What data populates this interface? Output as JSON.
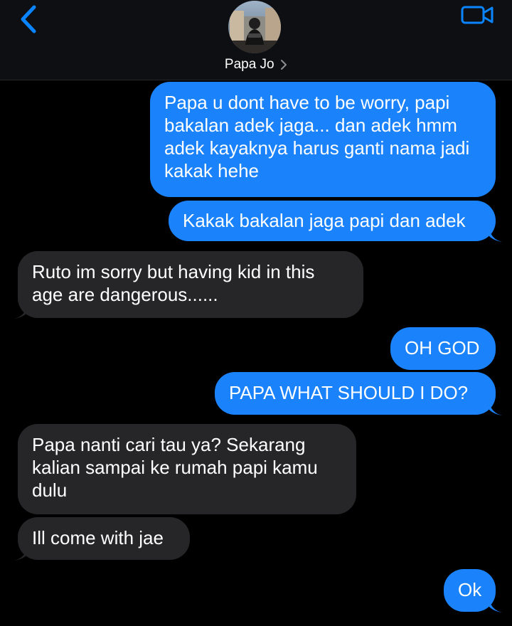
{
  "header": {
    "contact_name": "Papa Jo",
    "accent_color": "#0A84FF"
  },
  "messages": [
    {
      "direction": "outgoing",
      "text": "Papa u dont have to be worry, papi bakalan adek jaga... dan adek hmm adek kayaknya harus ganti nama jadi kakak hehe"
    },
    {
      "direction": "outgoing",
      "text": "Kakak bakalan jaga papi dan adek"
    },
    {
      "direction": "incoming",
      "text": "Ruto im sorry but having kid in this age are dangerous......"
    },
    {
      "direction": "outgoing",
      "text": "OH GOD"
    },
    {
      "direction": "outgoing",
      "text": "PAPA WHAT SHOULD I DO?"
    },
    {
      "direction": "incoming",
      "text": "Papa nanti cari tau ya? Sekarang kalian sampai ke rumah papi kamu dulu"
    },
    {
      "direction": "incoming",
      "text": "Ill come with jae"
    },
    {
      "direction": "outgoing",
      "text": "Ok"
    }
  ],
  "colors": {
    "outgoing_bubble": "#1A82FB",
    "incoming_bubble": "#262629",
    "background": "#000000"
  }
}
